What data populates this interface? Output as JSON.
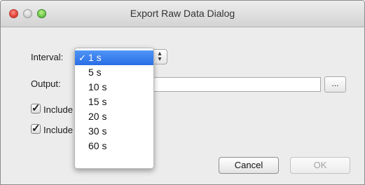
{
  "window": {
    "title": "Export Raw Data Dialog"
  },
  "form": {
    "interval_label": "Interval:",
    "output_label": "Output:",
    "output_value": "",
    "browse_label": "...",
    "include_description_label": "Include Description",
    "include_description_checked": true,
    "include_description_notes_label": "Include Description Notes",
    "include_description_notes_checked": true
  },
  "interval_menu": {
    "selected": "1 s",
    "check_mark": "✓",
    "options": [
      "1 s",
      "5 s",
      "10 s",
      "15 s",
      "20 s",
      "30 s",
      "60 s"
    ]
  },
  "buttons": {
    "cancel_label": "Cancel",
    "ok_label": "OK",
    "ok_enabled": false
  },
  "icons": {
    "close": "close-icon",
    "minimize": "minimize-icon",
    "zoom": "zoom-icon",
    "stepper": "up-down-chevron-icon",
    "checkmark": "checkmark-icon"
  },
  "colors": {
    "menu_highlight": "#3a82ee",
    "close": "#e0443a",
    "zoom": "#6ec84a"
  }
}
